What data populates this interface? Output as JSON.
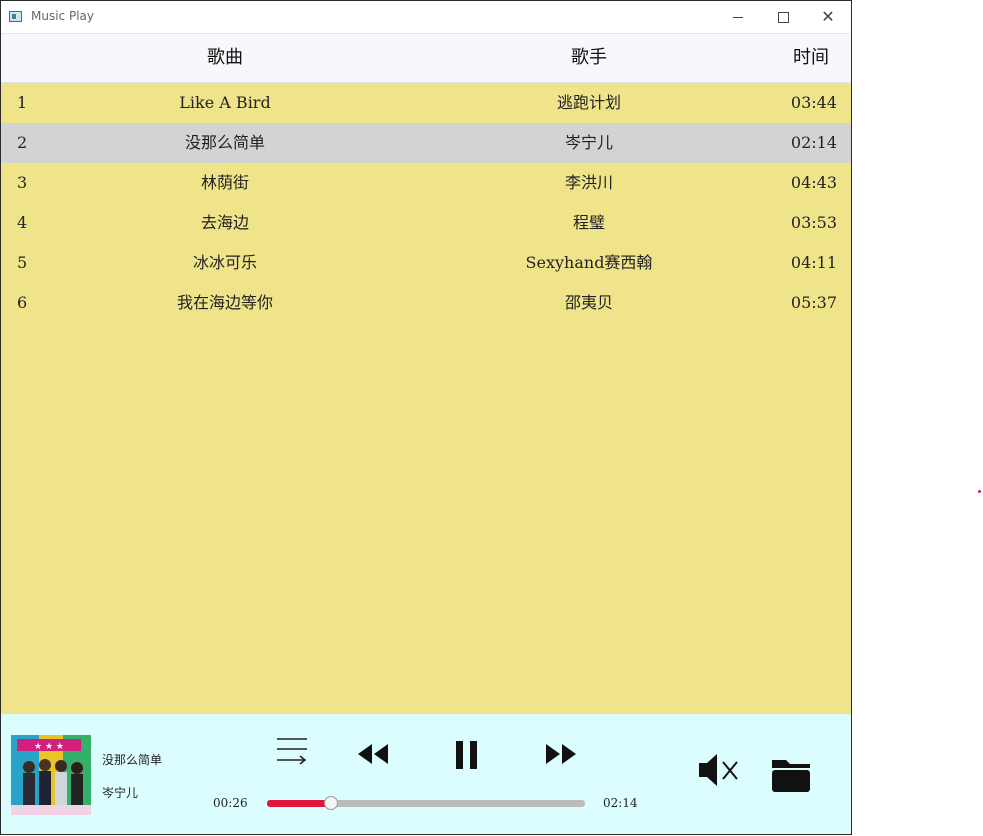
{
  "window": {
    "title": "Music Play"
  },
  "table": {
    "headers": {
      "song": "歌曲",
      "artist": "歌手",
      "time": "时间"
    },
    "rows": [
      {
        "index": "1",
        "song": "Like A Bird",
        "artist": "逃跑计划",
        "time": "03:44"
      },
      {
        "index": "2",
        "song": "没那么简单",
        "artist": "岑宁儿",
        "time": "02:14",
        "selected": true
      },
      {
        "index": "3",
        "song": "林荫街",
        "artist": "李洪川",
        "time": "04:43"
      },
      {
        "index": "4",
        "song": "去海边",
        "artist": "程璧",
        "time": "03:53"
      },
      {
        "index": "5",
        "song": "冰冰可乐",
        "artist": "Sexyhand赛西翰",
        "time": "04:11"
      },
      {
        "index": "6",
        "song": "我在海边等你",
        "artist": "邵夷贝",
        "time": "05:37"
      }
    ]
  },
  "player": {
    "now_playing_title": "没那么简单",
    "now_playing_artist": "岑宁儿",
    "current_time": "00:26",
    "total_time": "02:14",
    "progress_fraction": 0.2,
    "state": "playing",
    "muted": true,
    "icons": {
      "playlist": "playlist-icon",
      "previous": "rewind-icon",
      "pause": "pause-icon",
      "next": "fast-forward-icon",
      "mute": "volume-mute-icon",
      "open_folder": "folder-icon"
    }
  },
  "colors": {
    "row_background": "#f0e48a",
    "selected_row": "#d3d3d3",
    "player_background": "#dcfdfd",
    "progress_fill": "#e0183c"
  }
}
